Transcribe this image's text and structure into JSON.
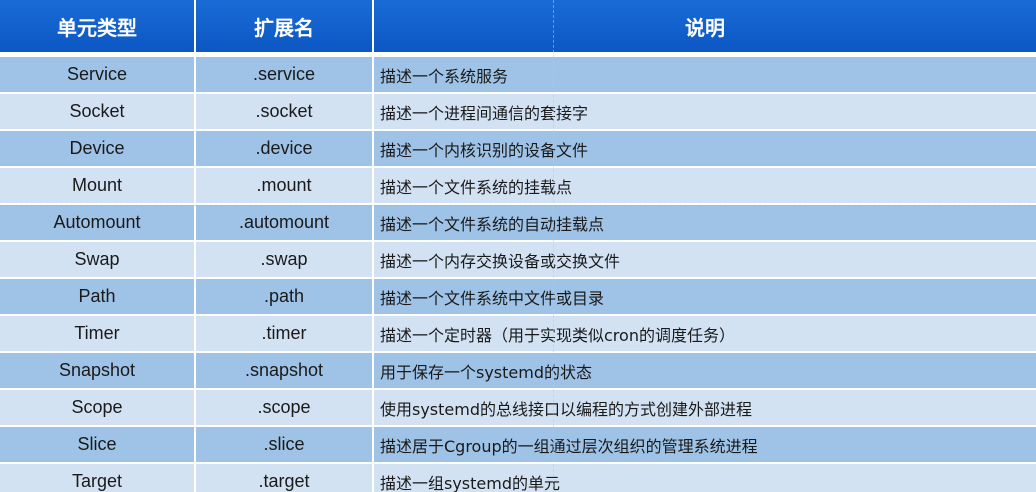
{
  "table": {
    "headers": [
      "单元类型",
      "扩展名",
      "说明"
    ],
    "rows": [
      {
        "type": "Service",
        "ext": ".service",
        "desc": "描述一个系统服务"
      },
      {
        "type": "Socket",
        "ext": ".socket",
        "desc": "描述一个进程间通信的套接字"
      },
      {
        "type": "Device",
        "ext": ".device",
        "desc": "描述一个内核识别的设备文件"
      },
      {
        "type": "Mount",
        "ext": ".mount",
        "desc": "描述一个文件系统的挂载点"
      },
      {
        "type": "Automount",
        "ext": ".automount",
        "desc": "描述一个文件系统的自动挂载点"
      },
      {
        "type": "Swap",
        "ext": ".swap",
        "desc": "描述一个内存交换设备或交换文件"
      },
      {
        "type": "Path",
        "ext": ".path",
        "desc": "描述一个文件系统中文件或目录"
      },
      {
        "type": "Timer",
        "ext": ".timer",
        "desc": "描述一个定时器（用于实现类似cron的调度任务）"
      },
      {
        "type": "Snapshot",
        "ext": ".snapshot",
        "desc": "用于保存一个systemd的状态"
      },
      {
        "type": "Scope",
        "ext": ".scope",
        "desc": "使用systemd的总线接口以编程的方式创建外部进程"
      },
      {
        "type": "Slice",
        "ext": ".slice",
        "desc": "描述居于Cgroup的一组通过层次组织的管理系统进程"
      },
      {
        "type": "Target",
        "ext": ".target",
        "desc": "描述一组systemd的单元"
      }
    ]
  },
  "colors": {
    "header_bg": "#0b57c4",
    "row_dark": "#9ec3e6",
    "row_light": "#d2e2f3"
  }
}
